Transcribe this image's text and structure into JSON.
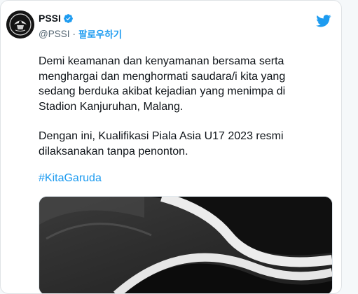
{
  "account": {
    "display_name": "PSSI",
    "handle": "@PSSI",
    "separator": "·",
    "follow_label": "팔로우하기"
  },
  "tweet": {
    "paragraph1": "Demi keamanan dan kenyamanan bersama serta\nmenghargai dan menghormati saudara/i kita yang\nsedang berduka akibat kejadian yang menimpa di\nStadion Kanjuruhan, Malang.",
    "paragraph2": "Dengan ini, Kualifikasi Piala Asia U17 2023 resmi\ndilaksanakan tanpa penonton.",
    "hashtag": "#KitaGaruda"
  },
  "icons": {
    "verified": "verified-badge-icon",
    "brand": "twitter-bird-icon",
    "avatar": "pssi-logo"
  },
  "colors": {
    "link": "#1d9bf0",
    "text": "#0f1419",
    "muted": "#536471",
    "media_bg": "#2f2f2f"
  }
}
